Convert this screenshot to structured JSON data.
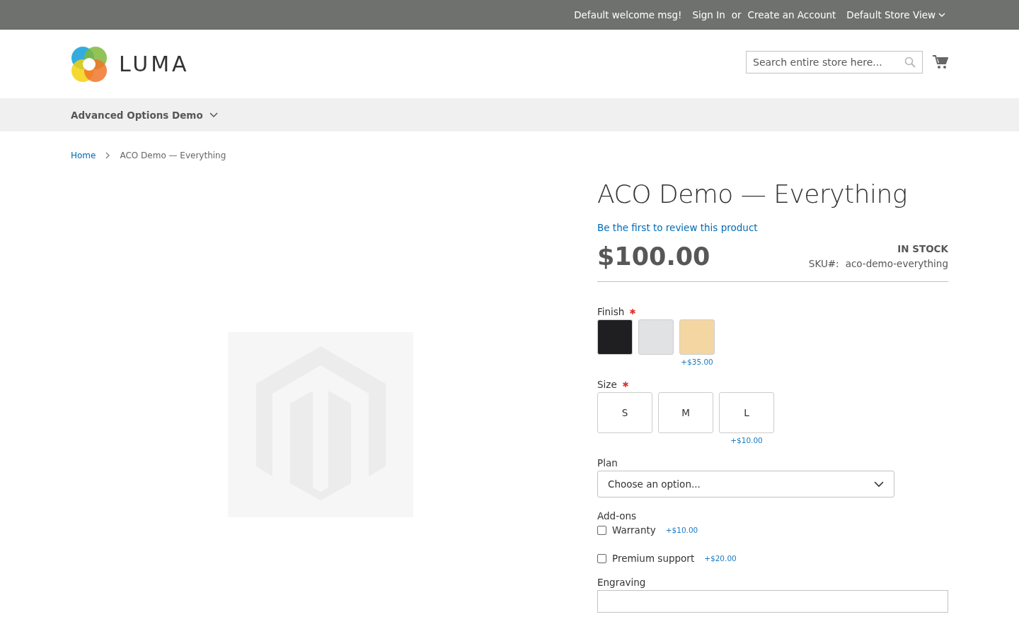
{
  "top_bar": {
    "welcome": "Default welcome msg!",
    "sign_in": "Sign In",
    "or": "or",
    "create_account": "Create an Account",
    "store_view": "Default Store View"
  },
  "header": {
    "logo_text": "LUMA",
    "search": {
      "placeholder": "Search entire store here..."
    }
  },
  "nav": {
    "items": [
      {
        "label": "Advanced Options Demo",
        "expanded": false
      }
    ]
  },
  "breadcrumbs": [
    {
      "label": "Home",
      "kind": "link"
    },
    {
      "label": "ACO Demo — Everything",
      "kind": "current"
    }
  ],
  "product": {
    "title": "ACO Demo — Everything",
    "review_link": "Be the first to review this product",
    "price": "$100.00",
    "stock": "IN STOCK",
    "sku_label": "SKU#:",
    "sku": "aco-demo-everything",
    "options": [
      {
        "kind": "color",
        "label": "Finish",
        "required": true,
        "swatches": [
          {
            "color": "#1f1f21"
          },
          {
            "color": "#e1e2e4"
          },
          {
            "color": "#f4d6a2",
            "price": "+$35.00"
          }
        ]
      },
      {
        "kind": "text_swatch",
        "label": "Size",
        "required": true,
        "swatches": [
          {
            "label": "S"
          },
          {
            "label": "M"
          },
          {
            "label": "L",
            "price": "+$10.00"
          }
        ]
      },
      {
        "kind": "select",
        "label": "Plan",
        "required": false,
        "placeholder": "Choose an option..."
      },
      {
        "kind": "checkbox",
        "label": "Add-ons",
        "required": false,
        "items": [
          {
            "label": "Warranty",
            "price": "+$10.00",
            "checked": false
          },
          {
            "label": "Premium support",
            "price": "+$20.00",
            "checked": false
          }
        ]
      },
      {
        "kind": "text",
        "label": "Engraving",
        "required": false
      }
    ]
  }
}
